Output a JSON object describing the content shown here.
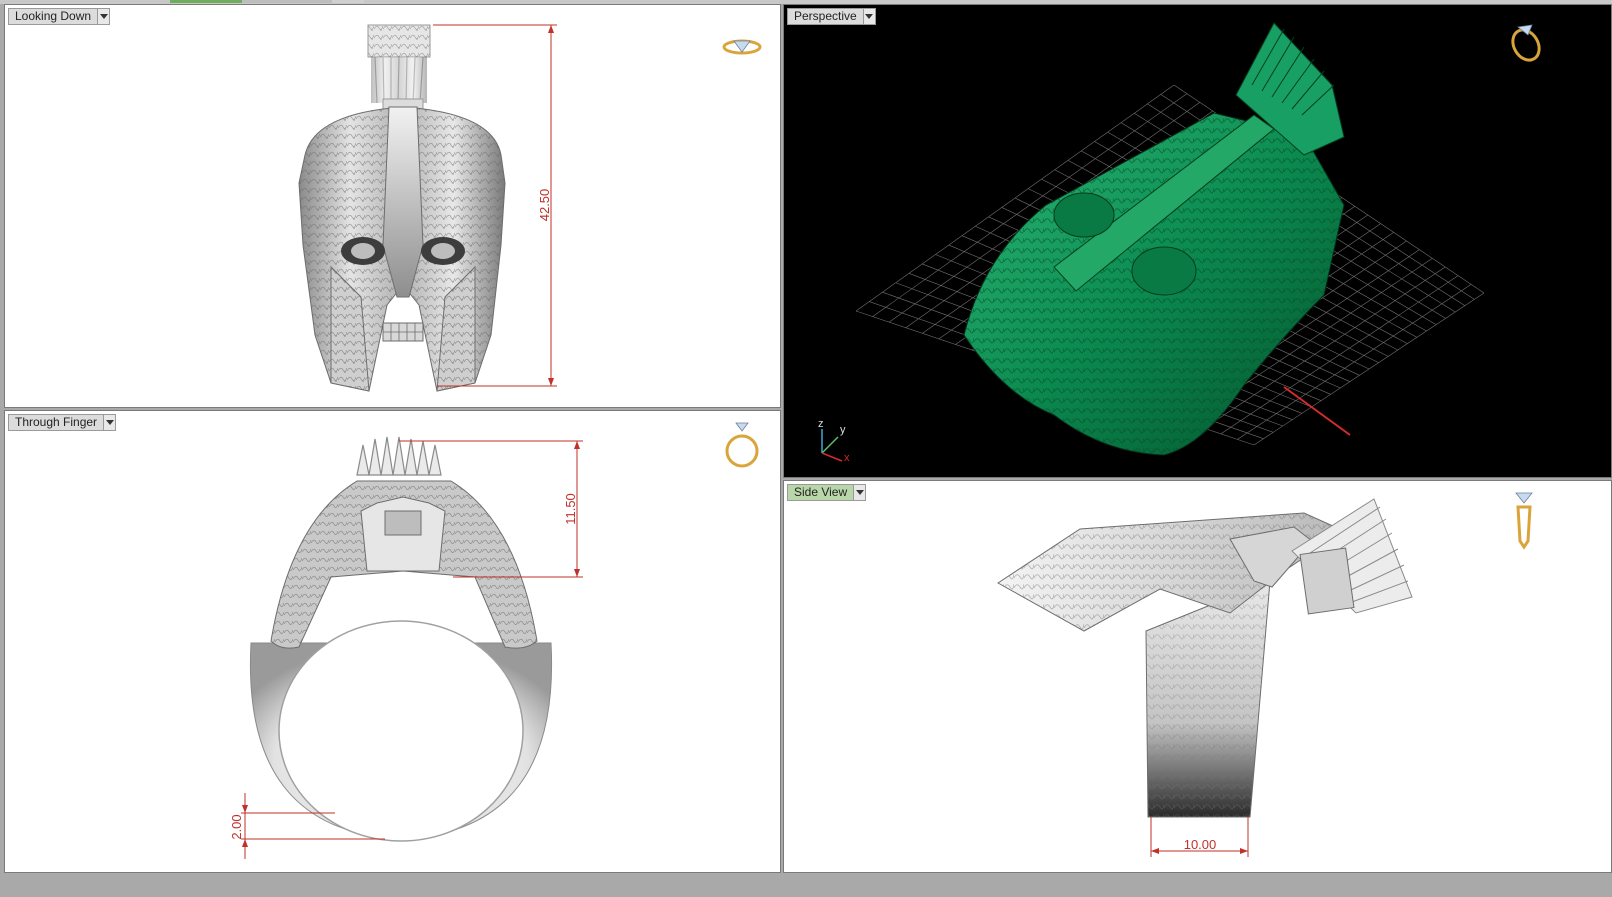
{
  "viewports": {
    "top_left": {
      "label": "Looking Down",
      "dimension": "42.50"
    },
    "bottom_left": {
      "label": "Through Finger",
      "dimension_top": "11.50",
      "dimension_bottom": "2.00"
    },
    "top_right": {
      "label": "Perspective",
      "axes": {
        "z": "z",
        "y": "y",
        "x": "x"
      }
    },
    "bottom_right": {
      "label": "Side View",
      "dimension": "10.00"
    }
  },
  "colors": {
    "dimension_line": "#c0312b",
    "model_green": "#0b8a4f",
    "grid": "#6f6f6f",
    "active_tab": "#b8d6a8"
  }
}
